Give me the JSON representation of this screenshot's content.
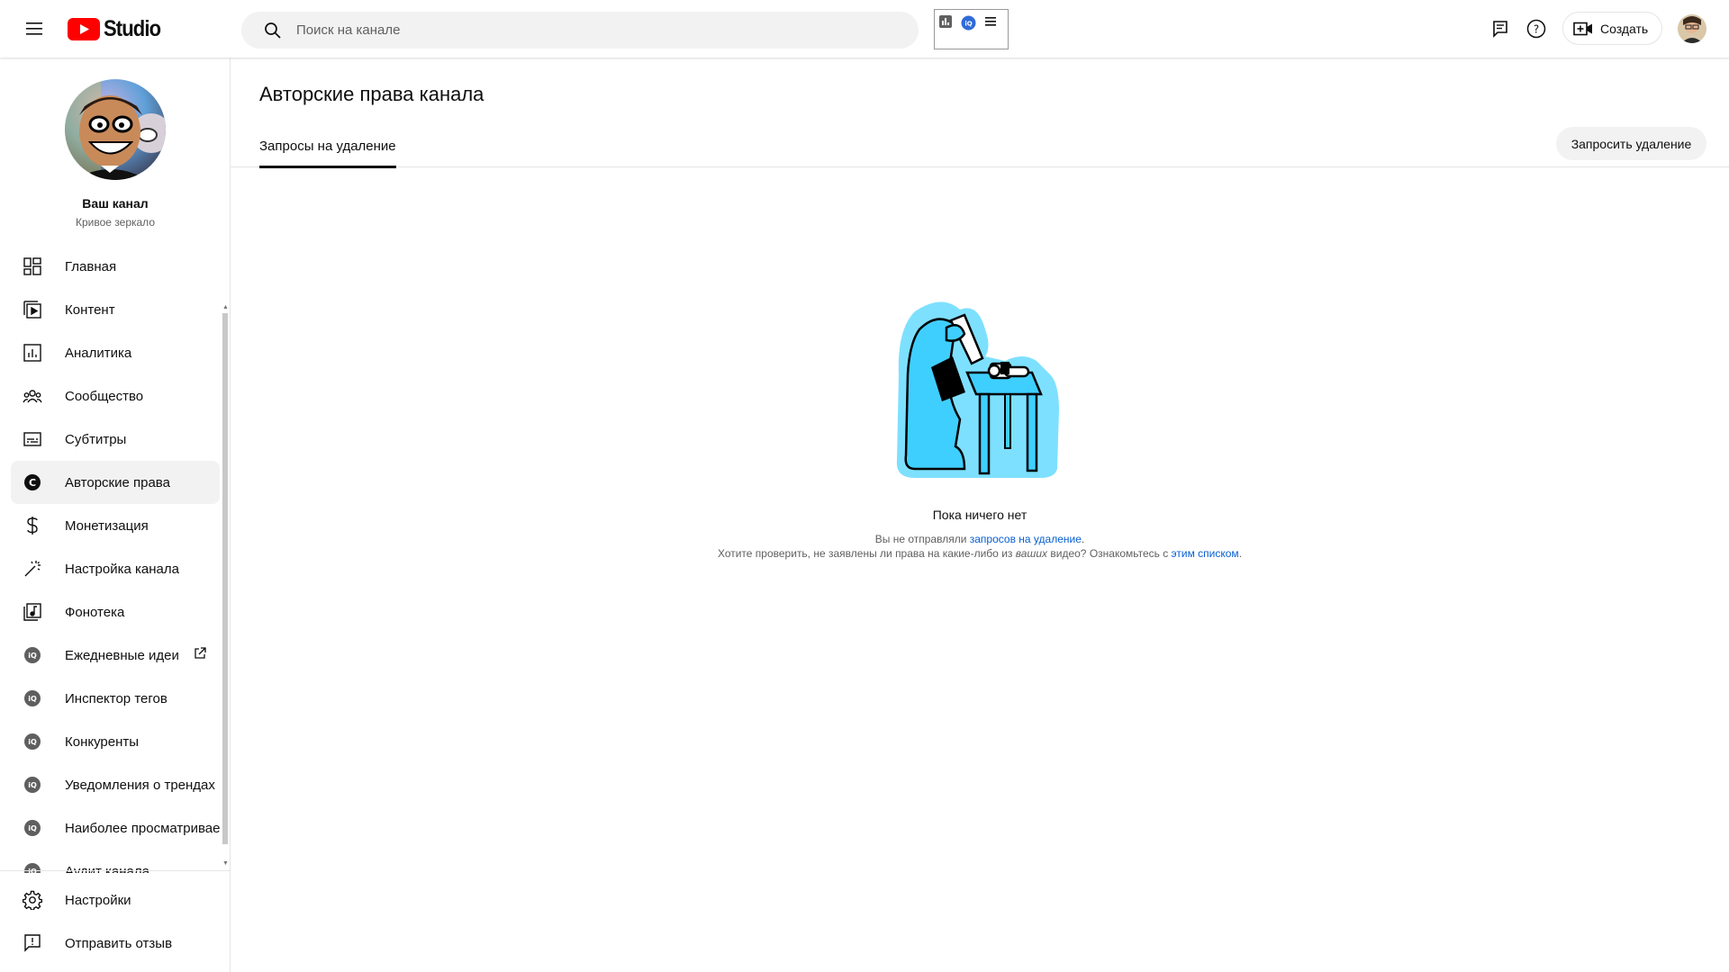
{
  "header": {
    "logo_text": "Studio",
    "search_placeholder": "Поиск на канале",
    "create_label": "Создать"
  },
  "sidebar": {
    "channel_title": "Ваш канал",
    "channel_name": "Кривое зеркало",
    "items": [
      {
        "label": "Главная",
        "icon": "dashboard-icon"
      },
      {
        "label": "Контент",
        "icon": "content-icon"
      },
      {
        "label": "Аналитика",
        "icon": "analytics-icon"
      },
      {
        "label": "Сообщество",
        "icon": "community-icon"
      },
      {
        "label": "Субтитры",
        "icon": "subtitles-icon"
      },
      {
        "label": "Авторские права",
        "icon": "copyright-icon",
        "active": true
      },
      {
        "label": "Монетизация",
        "icon": "dollar-icon"
      },
      {
        "label": "Настройка канала",
        "icon": "magic-wand-icon"
      },
      {
        "label": "Фонотека",
        "icon": "music-library-icon"
      },
      {
        "label": "Ежедневные идеи",
        "icon": "vidiq-icon",
        "external": true
      },
      {
        "label": "Инспектор тегов",
        "icon": "vidiq-icon"
      },
      {
        "label": "Конкуренты",
        "icon": "vidiq-icon"
      },
      {
        "label": "Уведомления о трендах",
        "icon": "vidiq-icon"
      },
      {
        "label": "Наиболее просматриваемые",
        "icon": "vidiq-icon"
      },
      {
        "label": "Аудит канала",
        "icon": "vidiq-icon"
      }
    ],
    "bottom_items": [
      {
        "label": "Настройки",
        "icon": "gear-icon"
      },
      {
        "label": "Отправить отзыв",
        "icon": "feedback-icon"
      }
    ]
  },
  "main": {
    "page_title": "Авторские права канала",
    "tabs": [
      {
        "label": "Запросы на удаление",
        "active": true
      }
    ],
    "request_button": "Запросить удаление",
    "empty": {
      "title": "Пока ничего нет",
      "line1_prefix": "Вы не отправляли ",
      "line1_link": "запросов на удаление",
      "line1_suffix": ".",
      "line2_prefix": "Хотите проверить, не заявлены ли права на какие-либо из ",
      "line2_emph": "ваших",
      "line2_mid": " видео? Ознакомьтесь с ",
      "line2_link": "этим списком",
      "line2_suffix": "."
    }
  },
  "colors": {
    "brand_red": "#ff0000",
    "link_blue": "#065fd4",
    "illustration_cyan": "#3fcfff"
  }
}
